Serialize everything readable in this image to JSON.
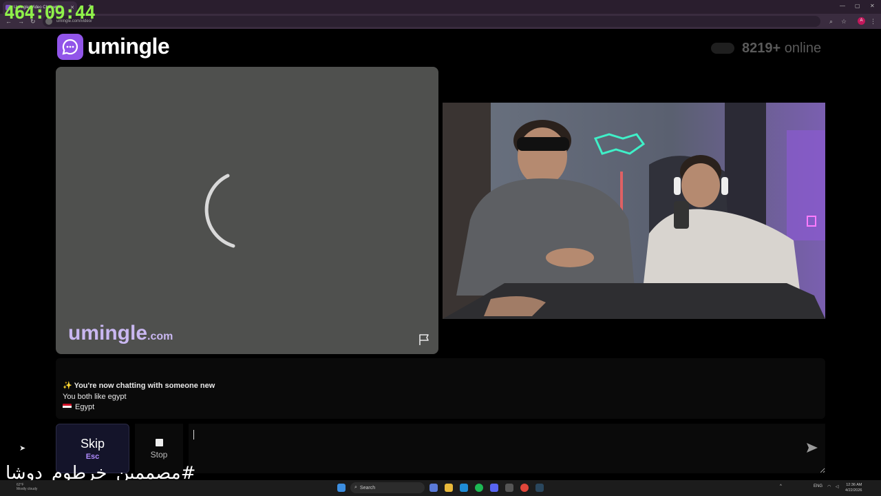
{
  "browser": {
    "tab_title": "Umingle: Video Chat with...",
    "url": "umingle.com/video/",
    "profile_initial": "A"
  },
  "overlay": {
    "timer": "464:09:44",
    "hashtag": "#مصممين_خرطوم_دوشا"
  },
  "header": {
    "logo_text": "umingle",
    "online_count": "8219+",
    "online_label": "online"
  },
  "stranger_video": {
    "watermark_name": "umingle",
    "watermark_domain": ".com"
  },
  "chat": {
    "messages": [
      {
        "icon": "✨",
        "text": "You're now chatting with someone new"
      },
      {
        "text": "You both like egypt"
      },
      {
        "country": "Egypt"
      }
    ]
  },
  "controls": {
    "skip_label": "Skip",
    "skip_shortcut": "Esc",
    "stop_label": "Stop",
    "input_value": ""
  },
  "taskbar": {
    "weather_temp": "62°F",
    "weather_desc": "Mostly cloudy",
    "search_placeholder": "Search",
    "lang": "ENG",
    "time": "12:36 AM",
    "date": "4/22/2026"
  },
  "colors": {
    "brand_purple": "#9155e9",
    "timer_green": "#8ff04a",
    "skip_accent": "#b08bff"
  }
}
